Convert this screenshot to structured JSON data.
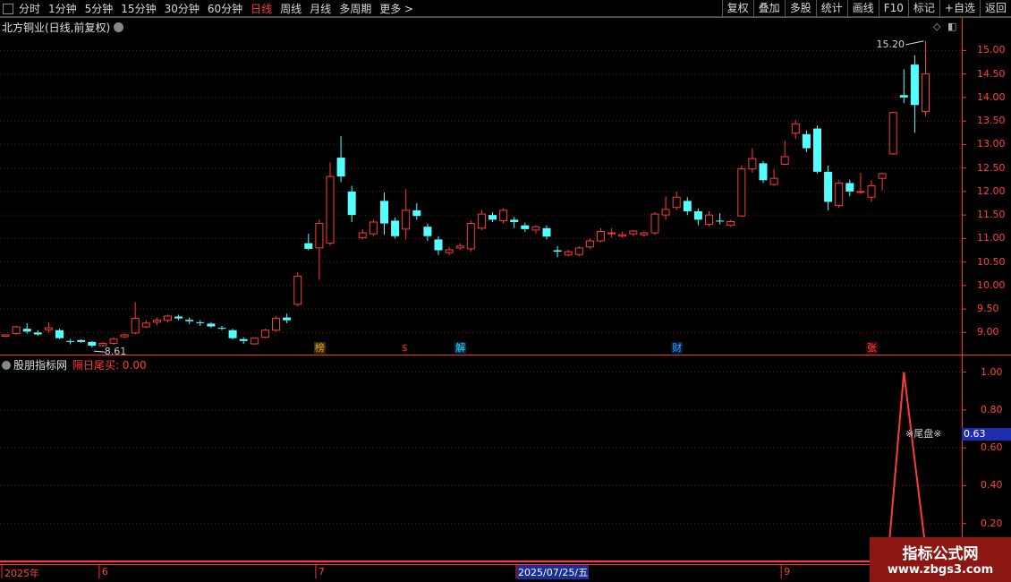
{
  "toolbar": {
    "periods": [
      "分时",
      "1分钟",
      "5分钟",
      "15分钟",
      "30分钟",
      "60分钟",
      "日线",
      "周线",
      "月线",
      "多周期",
      "更多 >"
    ],
    "active_period": "日线",
    "right_buttons": [
      "复权",
      "叠加",
      "多股",
      "统计",
      "画线",
      "F10",
      "标记",
      "+自选",
      "返回"
    ]
  },
  "chart_title": "北方铜业(日线,前复权)",
  "sub_panel": {
    "name": "股朋指标网",
    "indicator": "隔日尾买: 0.00",
    "current_value": "0.63",
    "annotation": "※尾盘※"
  },
  "price_annotations": {
    "high": "15.20",
    "low": "8.61"
  },
  "event_markers": [
    {
      "text": "榜",
      "color": "#f0a040",
      "bg": "#3a2a00",
      "index": 29
    },
    {
      "text": "$",
      "color": "#ff3030",
      "bg": "#000",
      "index": 37
    },
    {
      "text": "解",
      "color": "#40d0ff",
      "bg": "#003040",
      "index": 42
    },
    {
      "text": "财",
      "color": "#40a0ff",
      "bg": "#001a40",
      "index": 62
    },
    {
      "text": "张",
      "color": "#ff5050",
      "bg": "#400000",
      "index": 80
    }
  ],
  "colors": {
    "up": "#ff3a3a",
    "down": "#54ffff",
    "grid": "#7a1010",
    "axis": "#ff3030"
  },
  "dates": {
    "labels": [
      {
        "text": "2025年",
        "index": 0
      },
      {
        "text": "6",
        "index": 9
      },
      {
        "text": "7",
        "index": 29
      },
      {
        "text": "9",
        "index": 72
      }
    ],
    "selected": "2025/07/25/五"
  },
  "chart_data": {
    "type": "candlestick",
    "title": "北方铜业(日线,前复权)",
    "price_axis_ticks": [
      15.0,
      14.5,
      14.0,
      13.5,
      13.0,
      12.5,
      12.0,
      11.5,
      11.0,
      10.5,
      10.0,
      9.5,
      9.0
    ],
    "indicator_axis_ticks": [
      1.0,
      0.8,
      0.6,
      0.4,
      0.2
    ],
    "ylim_price": [
      8.55,
      15.35
    ],
    "ylim_indicator": [
      0,
      1.05
    ],
    "candles": [
      [
        8.92,
        8.95,
        8.9,
        8.96
      ],
      [
        8.98,
        9.12,
        8.95,
        9.15
      ],
      [
        9.08,
        9.02,
        8.98,
        9.2
      ],
      [
        9.0,
        8.96,
        8.93,
        9.05
      ],
      [
        9.06,
        9.1,
        9.0,
        9.22
      ],
      [
        9.05,
        8.88,
        8.86,
        9.08
      ],
      [
        8.82,
        8.8,
        8.75,
        8.86
      ],
      [
        8.84,
        8.8,
        8.78,
        8.86
      ],
      [
        8.8,
        8.72,
        8.68,
        8.82
      ],
      [
        8.72,
        8.77,
        8.7,
        8.8
      ],
      [
        8.77,
        8.86,
        8.74,
        8.9
      ],
      [
        8.91,
        8.95,
        8.88,
        8.98
      ],
      [
        8.99,
        9.3,
        8.96,
        9.65
      ],
      [
        9.12,
        9.2,
        9.1,
        9.26
      ],
      [
        9.22,
        9.26,
        9.15,
        9.32
      ],
      [
        9.26,
        9.35,
        9.22,
        9.38
      ],
      [
        9.34,
        9.3,
        9.26,
        9.38
      ],
      [
        9.27,
        9.24,
        9.18,
        9.32
      ],
      [
        9.22,
        9.2,
        9.14,
        9.26
      ],
      [
        9.19,
        9.13,
        9.1,
        9.22
      ],
      [
        9.1,
        9.08,
        9.05,
        9.14
      ],
      [
        9.05,
        8.88,
        8.85,
        9.08
      ],
      [
        8.86,
        8.82,
        8.76,
        8.9
      ],
      [
        8.76,
        8.88,
        8.74,
        8.9
      ],
      [
        8.9,
        9.05,
        8.88,
        9.08
      ],
      [
        9.05,
        9.3,
        9.02,
        9.34
      ],
      [
        9.32,
        9.26,
        9.2,
        9.4
      ],
      [
        9.6,
        10.2,
        9.56,
        10.28
      ],
      [
        10.9,
        10.78,
        10.75,
        11.1
      ],
      [
        10.8,
        11.32,
        10.12,
        11.4
      ],
      [
        10.9,
        12.32,
        10.85,
        12.62
      ],
      [
        12.72,
        12.32,
        12.2,
        13.18
      ],
      [
        12.0,
        11.5,
        11.35,
        12.12
      ],
      [
        11.02,
        11.12,
        10.98,
        11.2
      ],
      [
        11.1,
        11.35,
        11.05,
        11.4
      ],
      [
        11.8,
        11.32,
        11.08,
        11.98
      ],
      [
        11.38,
        11.05,
        11.0,
        11.45
      ],
      [
        11.2,
        11.6,
        10.98,
        12.05
      ],
      [
        11.6,
        11.48,
        11.4,
        11.75
      ],
      [
        11.25,
        11.05,
        10.95,
        11.32
      ],
      [
        10.98,
        10.75,
        10.65,
        11.05
      ],
      [
        10.7,
        10.76,
        10.65,
        10.82
      ],
      [
        10.8,
        10.84,
        10.76,
        10.9
      ],
      [
        10.78,
        11.32,
        10.72,
        11.38
      ],
      [
        11.22,
        11.52,
        11.18,
        11.6
      ],
      [
        11.5,
        11.4,
        11.35,
        11.56
      ],
      [
        11.38,
        11.6,
        11.32,
        11.64
      ],
      [
        11.4,
        11.35,
        11.22,
        11.46
      ],
      [
        11.28,
        11.2,
        11.14,
        11.34
      ],
      [
        11.18,
        11.25,
        11.1,
        11.28
      ],
      [
        11.22,
        11.04,
        10.98,
        11.28
      ],
      [
        10.75,
        10.72,
        10.6,
        10.84
      ],
      [
        10.65,
        10.72,
        10.62,
        10.76
      ],
      [
        10.66,
        10.8,
        10.62,
        10.84
      ],
      [
        10.82,
        10.95,
        10.78,
        11.0
      ],
      [
        10.95,
        11.15,
        10.92,
        11.22
      ],
      [
        11.1,
        11.12,
        11.02,
        11.22
      ],
      [
        11.05,
        11.08,
        11.02,
        11.15
      ],
      [
        11.1,
        11.16,
        11.05,
        11.18
      ],
      [
        11.08,
        11.12,
        11.04,
        11.15
      ],
      [
        11.12,
        11.52,
        11.08,
        11.56
      ],
      [
        11.5,
        11.62,
        11.4,
        11.9
      ],
      [
        11.66,
        11.88,
        11.6,
        12.0
      ],
      [
        11.8,
        11.58,
        11.5,
        11.88
      ],
      [
        11.58,
        11.4,
        11.28,
        11.64
      ],
      [
        11.3,
        11.5,
        11.26,
        11.58
      ],
      [
        11.38,
        11.36,
        11.3,
        11.54
      ],
      [
        11.28,
        11.36,
        11.25,
        11.4
      ],
      [
        11.48,
        12.48,
        11.46,
        12.55
      ],
      [
        12.48,
        12.7,
        12.4,
        12.92
      ],
      [
        12.6,
        12.24,
        12.18,
        12.65
      ],
      [
        12.15,
        12.28,
        12.12,
        12.48
      ],
      [
        12.58,
        12.74,
        12.56,
        13.08
      ],
      [
        13.24,
        13.44,
        13.12,
        13.52
      ],
      [
        13.22,
        12.92,
        12.84,
        13.3
      ],
      [
        13.34,
        12.42,
        12.38,
        13.4
      ],
      [
        12.42,
        11.78,
        11.6,
        12.55
      ],
      [
        11.7,
        12.18,
        11.65,
        12.24
      ],
      [
        12.18,
        12.0,
        11.9,
        12.25
      ],
      [
        11.98,
        12.0,
        11.95,
        12.4
      ],
      [
        11.88,
        12.12,
        11.78,
        12.24
      ],
      [
        12.28,
        12.38,
        12.02,
        12.4
      ],
      [
        12.8,
        13.68,
        12.78,
        13.7
      ],
      [
        14.05,
        14.0,
        13.88,
        14.6
      ],
      [
        14.7,
        13.84,
        13.25,
        14.9
      ],
      [
        13.7,
        14.5,
        13.6,
        15.2
      ]
    ],
    "indicator": {
      "start_index": 82,
      "peak_index": 83,
      "peak_value": 1.0,
      "current_value": 0.63
    }
  }
}
